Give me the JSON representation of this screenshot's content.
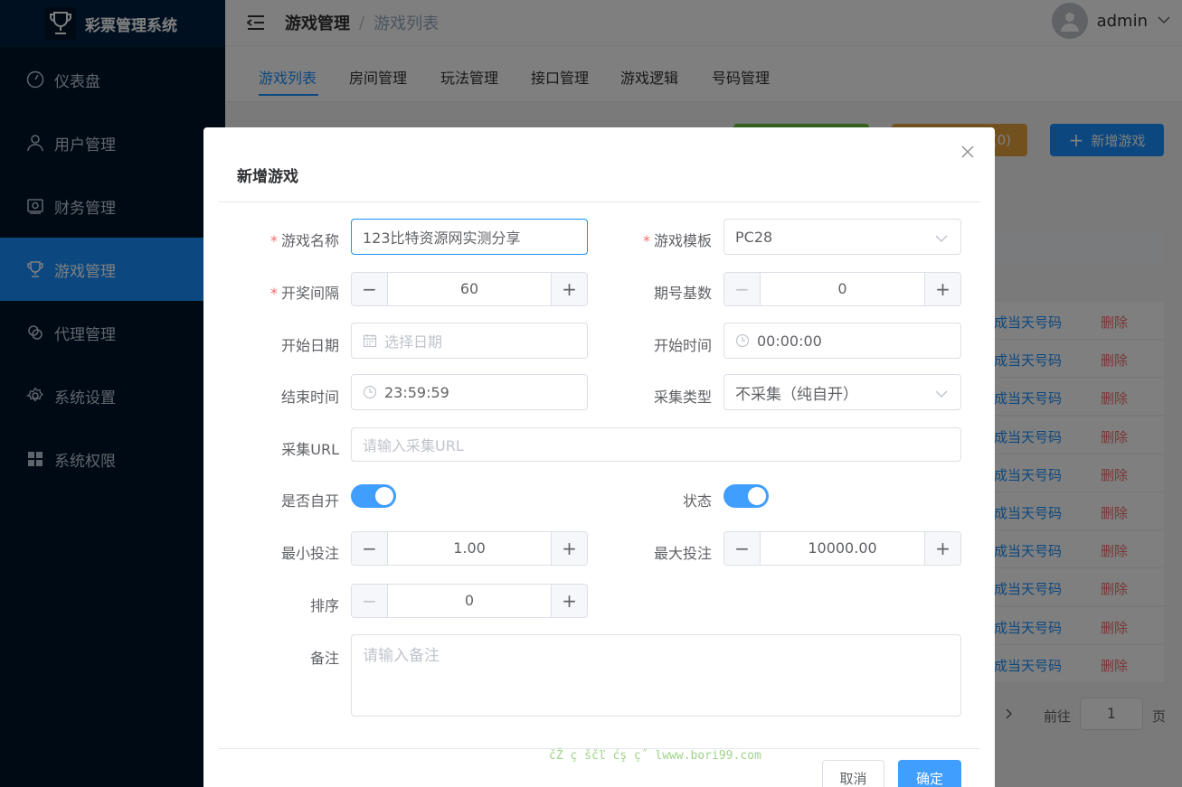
{
  "app": {
    "title": "彩票管理系统"
  },
  "sidebar": {
    "items": [
      {
        "label": "仪表盘",
        "icon": "dashboard-icon"
      },
      {
        "label": "用户管理",
        "icon": "user-icon"
      },
      {
        "label": "财务管理",
        "icon": "wallet-icon"
      },
      {
        "label": "游戏管理",
        "icon": "trophy-icon",
        "active": true
      },
      {
        "label": "代理管理",
        "icon": "agent-icon"
      },
      {
        "label": "系统设置",
        "icon": "gear-icon"
      },
      {
        "label": "系统权限",
        "icon": "grid-icon"
      }
    ]
  },
  "header": {
    "breadcrumb": [
      "游戏管理",
      "/",
      "游戏列表"
    ],
    "user": "admin"
  },
  "tabs": [
    "游戏列表",
    "房间管理",
    "玩法管理",
    "接口管理",
    "游戏逻辑",
    "号码管理"
  ],
  "toolbar": {
    "orange_tail": "(0)",
    "add_label": "新增游戏"
  },
  "table": {
    "row_action_generate": "生成当天号码",
    "row_action_delete": "删除",
    "row_count": 10
  },
  "pagination": {
    "goto": "前往",
    "page": "1",
    "page_suffix": "页"
  },
  "dialog": {
    "title": "新增游戏",
    "fields": {
      "name": {
        "label": "游戏名称",
        "value": "123比特资源网实测分享"
      },
      "template": {
        "label": "游戏模板",
        "value": "PC28"
      },
      "interval": {
        "label": "开奖间隔",
        "value": "60"
      },
      "issue_base": {
        "label": "期号基数",
        "value": "0"
      },
      "start_date": {
        "label": "开始日期",
        "placeholder": "选择日期"
      },
      "start_time": {
        "label": "开始时间",
        "value": "00:00:00"
      },
      "end_time": {
        "label": "结束时间",
        "value": "23:59:59"
      },
      "collect_type": {
        "label": "采集类型",
        "value": "不采集（纯自开）"
      },
      "collect_url": {
        "label": "采集URL",
        "placeholder": "请输入采集URL"
      },
      "self_open": {
        "label": "是否自开",
        "on": true
      },
      "status": {
        "label": "状态",
        "on": true
      },
      "min_bet": {
        "label": "最小投注",
        "value": "1.00"
      },
      "max_bet": {
        "label": "最大投注",
        "value": "10000.00"
      },
      "sort": {
        "label": "排序",
        "value": "0"
      },
      "remark": {
        "label": "备注",
        "placeholder": "请输入备注"
      }
    },
    "cancel_label": "取消",
    "ok_label": "确定",
    "watermark": "čŽ ç ščľ ćş ç˝ lwww.bori99.com"
  },
  "colors": {
    "primary": "#1890ff",
    "sidebar": "#001529",
    "danger": "#f56c6c",
    "success": "#67c23a",
    "warning": "#e6a23c"
  }
}
